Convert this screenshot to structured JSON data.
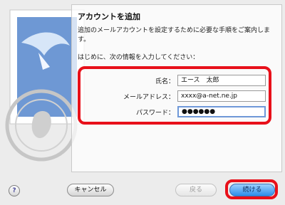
{
  "dialog": {
    "title": "アカウントを追加",
    "description": "追加のメールアカウントを設定するために必要な手順をご案内します。",
    "intro": "はじめに、次の情報を入力してください："
  },
  "form": {
    "fields": [
      {
        "label": "氏名：",
        "value": "エース　太郎"
      },
      {
        "label": "メールアドレス：",
        "value": "xxxx@a-net.ne.jp"
      },
      {
        "label": "パスワード：",
        "value": "●●●●●●"
      }
    ]
  },
  "buttons": {
    "help": "?",
    "cancel": "キャンセル",
    "back": "戻る",
    "continue": "続ける"
  },
  "colors": {
    "highlight": "#e8101a",
    "focus": "#6f98d8",
    "primary": "#2d8ee9"
  }
}
